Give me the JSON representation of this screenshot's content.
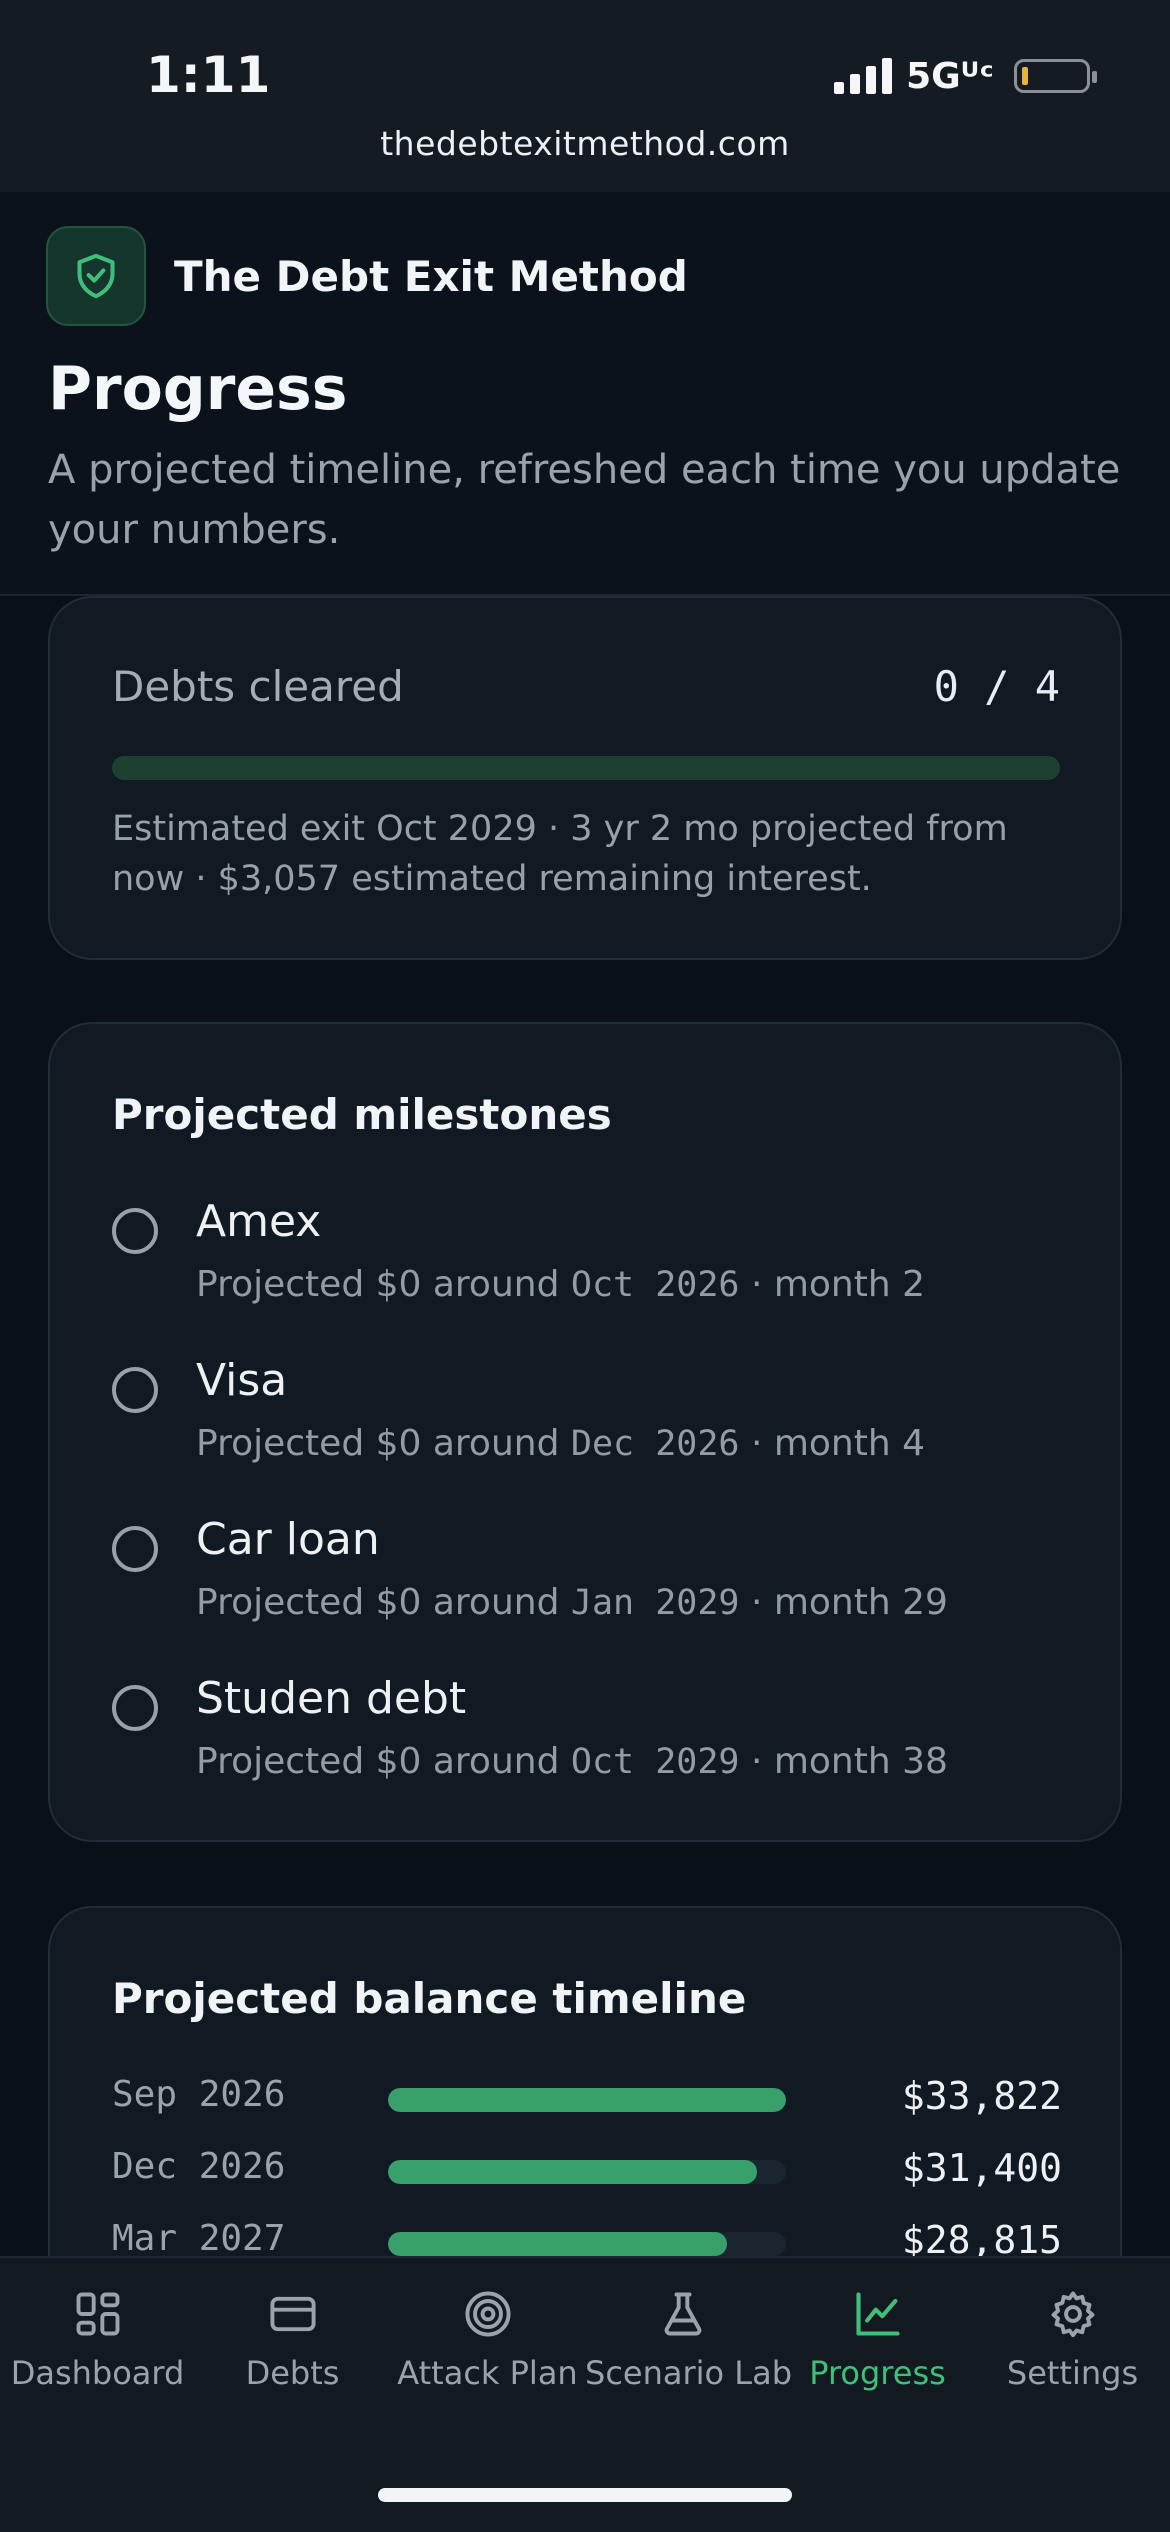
{
  "status": {
    "time": "1:11",
    "network": "5Gᵁᶜ"
  },
  "browser": {
    "url": "thedebtexitmethod.com"
  },
  "brand": {
    "name": "The Debt Exit Method",
    "icon": "shield-check-icon"
  },
  "page": {
    "title": "Progress",
    "subtitle": "A projected timeline, refreshed each time you update your numbers."
  },
  "summary": {
    "label": "Debts cleared",
    "count": "0 / 4",
    "progress": 0,
    "exit_text": "Estimated exit Oct 2029 · 3 yr 2 mo projected from now · $3,057 estimated remaining interest."
  },
  "milestones": {
    "title": "Projected milestones",
    "prefix": "Projected $0 around",
    "items": [
      {
        "name": "Amex",
        "date": "Oct 2026",
        "month": "· month 2"
      },
      {
        "name": "Visa",
        "date": "Dec 2026",
        "month": "· month 4"
      },
      {
        "name": "Car loan",
        "date": "Jan 2029",
        "month": "· month 29"
      },
      {
        "name": "Studen debt",
        "date": "Oct 2029",
        "month": "· month 38"
      }
    ]
  },
  "timeline": {
    "title": "Projected balance timeline",
    "rows": [
      {
        "date": "Sep 2026",
        "amount": "$33,822",
        "value": 33822
      },
      {
        "date": "Dec 2026",
        "amount": "$31,400",
        "value": 31400
      },
      {
        "date": "Mar 2027",
        "amount": "$28,815",
        "value": 28815
      }
    ],
    "max_value": 33822
  },
  "nav": {
    "items": [
      {
        "label": "Dashboard",
        "icon": "dashboard-icon"
      },
      {
        "label": "Debts",
        "icon": "credit-card-icon"
      },
      {
        "label": "Attack Plan",
        "icon": "target-icon"
      },
      {
        "label": "Scenario Lab",
        "icon": "flask-icon"
      },
      {
        "label": "Progress",
        "icon": "chart-icon"
      },
      {
        "label": "Settings",
        "icon": "gear-icon"
      }
    ],
    "active": "Progress"
  },
  "colors": {
    "accent": "#3fbf7a",
    "bar": "#38a06a",
    "background": "#0a1018"
  }
}
